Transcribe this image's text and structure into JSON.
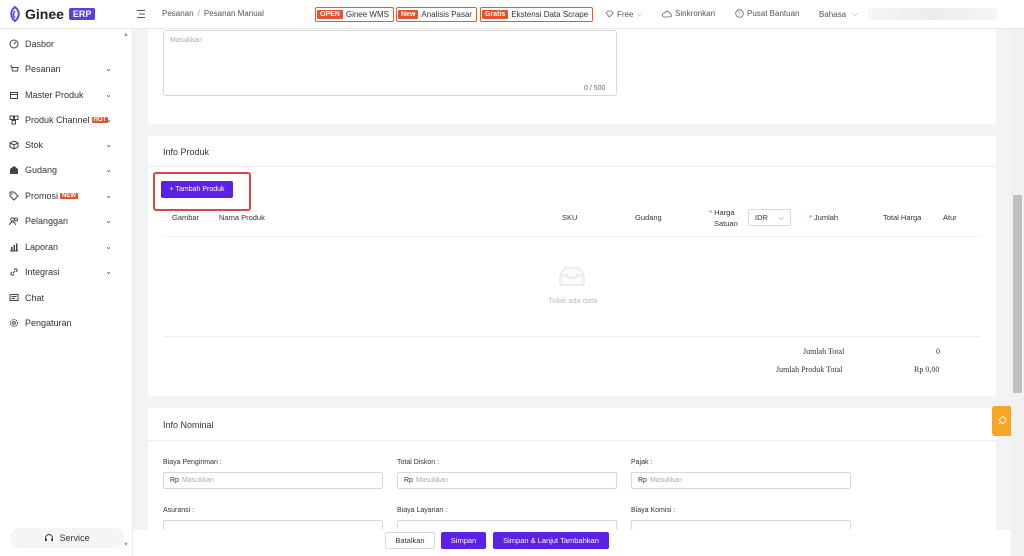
{
  "brand": {
    "name": "Ginee",
    "erp": "ERP"
  },
  "breadcrumb": {
    "parent": "Pesanan",
    "current": "Pesanan Manual"
  },
  "promos": [
    {
      "tag": "OPEN",
      "label": "Ginee WMS"
    },
    {
      "tag": "New",
      "label": "Analisis Pasar"
    },
    {
      "tag": "Gratis",
      "label": "Ekstensi Data Scrape"
    }
  ],
  "topnav": {
    "free": "Free",
    "sync": "Sinkronkan",
    "help": "Pusat Bantuan",
    "lang": "Bahasa"
  },
  "sidebar": {
    "items": [
      {
        "label": "Dasbor",
        "icon": "dashboard-icon"
      },
      {
        "label": "Pesanan",
        "icon": "cart-icon"
      },
      {
        "label": "Master Produk",
        "icon": "box-icon"
      },
      {
        "label": "Produk Channel",
        "icon": "channel-icon",
        "badge": "HOT"
      },
      {
        "label": "Stok",
        "icon": "cube-icon"
      },
      {
        "label": "Gudang",
        "icon": "warehouse-icon"
      },
      {
        "label": "Promosi",
        "icon": "tag-icon",
        "badge": "NEW"
      },
      {
        "label": "Pelanggan",
        "icon": "users-icon"
      },
      {
        "label": "Laporan",
        "icon": "chart-icon"
      },
      {
        "label": "Integrasi",
        "icon": "link-icon"
      },
      {
        "label": "Chat",
        "icon": "chat-icon"
      },
      {
        "label": "Pengaturan",
        "icon": "settings-icon"
      }
    ],
    "service": "Service"
  },
  "note": {
    "placeholder": "Masukkan",
    "counter": "0 / 500"
  },
  "product": {
    "title": "Info Produk",
    "add_button": "Tambah Produk",
    "columns": {
      "image": "Gambar",
      "name": "Nama Produk",
      "sku": "SKU",
      "warehouse": "Gudang",
      "unit_price_1": "Harga",
      "unit_price_2": "Satuan",
      "currency": "IDR",
      "qty": "Jumlah",
      "total": "Total Harga",
      "action": "Atur"
    },
    "empty": "Tidak ada data",
    "sum_qty_label": "Jumlah Total",
    "sum_qty_value": "0",
    "sum_total_label": "Jumlah Produk Total",
    "sum_total_value": "Rp 0,00"
  },
  "nominal": {
    "title": "Info Nominal",
    "fields": [
      {
        "label": "Biaya Pengiriman",
        "prefix": "Rp",
        "placeholder": "Masukkan"
      },
      {
        "label": "Total Diskon",
        "prefix": "Rp",
        "placeholder": "Masukkan"
      },
      {
        "label": "Pajak",
        "prefix": "Rp",
        "placeholder": "Masukkan"
      },
      {
        "label": "Asuransi"
      },
      {
        "label": "Biaya Layanan"
      },
      {
        "label": "Biaya Komisi"
      }
    ]
  },
  "actions": {
    "cancel": "Batalkan",
    "save": "Simpan",
    "save_more": "Simpan & Lanjut Tambahkan"
  },
  "colors": {
    "primary": "#5b21e6",
    "promo": "#e8512a",
    "highlight": "#e04545",
    "float": "#f5a623"
  }
}
